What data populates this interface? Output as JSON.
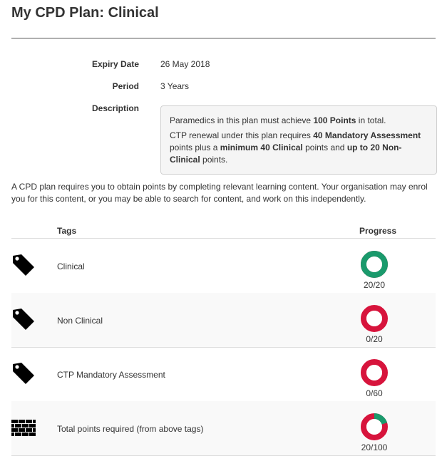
{
  "page": {
    "title": "My CPD Plan: Clinical"
  },
  "details": {
    "expiry_label": "Expiry Date",
    "expiry_value": "26 May 2018",
    "period_label": "Period",
    "period_value": "3 Years",
    "description_label": "Description",
    "description": {
      "p1_before": "Paramedics in this plan must achieve ",
      "p1_bold": "100 Points",
      "p1_after": " in total.",
      "p2_a": "CTP renewal under this plan requires ",
      "p2_b": "40 Mandatory Assessment",
      "p2_c": " points plus a ",
      "p2_d": "minimum 40 Clinical",
      "p2_e": " points and ",
      "p2_f": "up to 20 Non-Clinical",
      "p2_g": " points."
    }
  },
  "intro_text": "A CPD plan requires you to obtain points by completing relevant learning content. Your organisation may enrol you for this content, or you may be able to search for content, and work on this independently.",
  "table": {
    "headers": {
      "tags": "Tags",
      "progress": "Progress"
    },
    "rows": [
      {
        "icon": "tag-icon",
        "label": "Clinical",
        "progress_text": "20/20",
        "progress_fraction": 1.0
      },
      {
        "icon": "tag-icon",
        "label": "Non Clinical",
        "progress_text": "0/20",
        "progress_fraction": 0.0
      },
      {
        "icon": "tag-icon",
        "label": "CTP Mandatory Assessment",
        "progress_text": "0/60",
        "progress_fraction": 0.0
      },
      {
        "icon": "bricks-icon",
        "label": "Total points required (from above tags)",
        "progress_text": "20/100",
        "progress_fraction": 0.2
      }
    ]
  },
  "colors": {
    "complete": "#1a9a6c",
    "incomplete": "#d7143c",
    "donut_hole": "#ffffff",
    "icon": "#000000"
  }
}
